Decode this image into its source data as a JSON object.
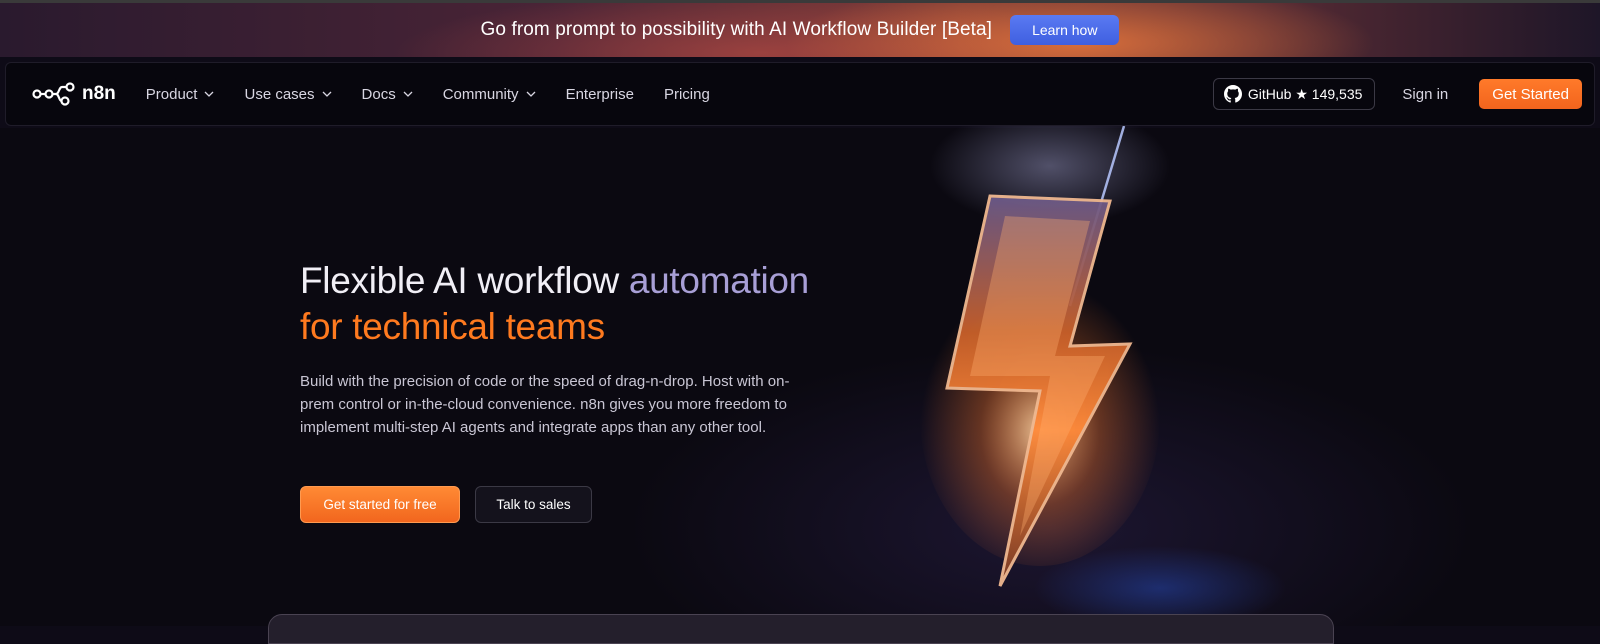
{
  "banner": {
    "text": "Go from prompt to possibility with AI Workflow Builder [Beta]",
    "button_label": "Learn how"
  },
  "nav": {
    "logo_text": "n8n",
    "items": [
      {
        "label": "Product",
        "dropdown": true
      },
      {
        "label": "Use cases",
        "dropdown": true
      },
      {
        "label": "Docs",
        "dropdown": true
      },
      {
        "label": "Community",
        "dropdown": true
      },
      {
        "label": "Enterprise",
        "dropdown": false
      },
      {
        "label": "Pricing",
        "dropdown": false
      }
    ],
    "github_label": "GitHub ★ 149,535",
    "signin_label": "Sign in",
    "get_started_label": "Get Started"
  },
  "hero": {
    "headline_part1": "Flexible AI workflow ",
    "headline_part2": "automation",
    "headline_part3": "for technical teams",
    "description": "Build with the precision of code or the speed of drag-n-drop. Host with on-prem control or in-the-cloud convenience. n8n gives you more freedom to implement multi-step AI agents and integrate apps than any other tool.",
    "primary_button": "Get started for free",
    "secondary_button": "Talk to sales"
  },
  "colors": {
    "accent_orange": "#ff7a1f",
    "accent_blue": "#4a6af0",
    "headline_purple": "#a89fd6",
    "background": "#0b0911"
  },
  "icons": {
    "logo": "n8n-logo-icon",
    "github": "github-icon",
    "chevron": "chevron-down-icon",
    "hero_art": "lightning-bolt-icon"
  }
}
